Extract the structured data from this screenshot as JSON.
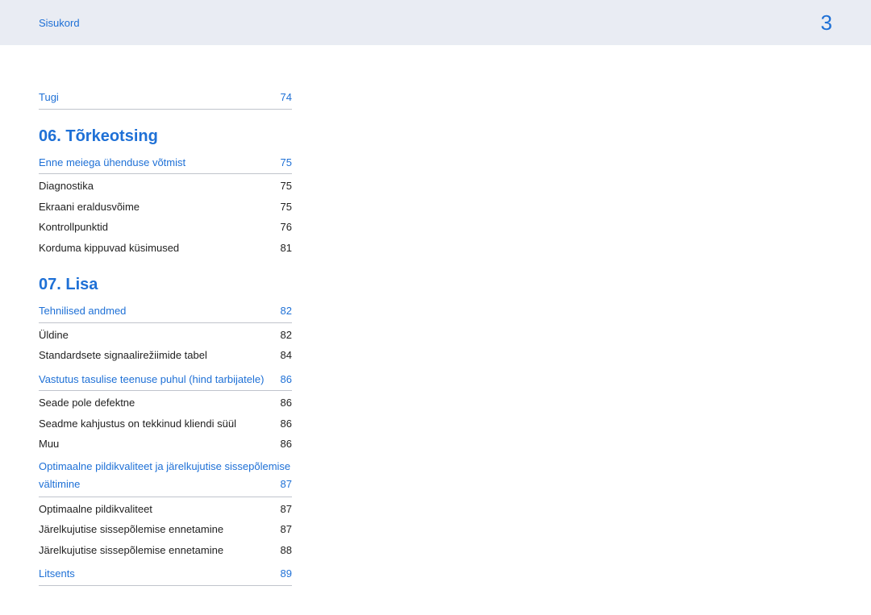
{
  "header": {
    "title": "Sisukord",
    "page": "3"
  },
  "sections": [
    {
      "heading": null,
      "groups": [
        {
          "subheading": {
            "label": "Tugi",
            "page": "74"
          },
          "items": []
        }
      ]
    },
    {
      "heading": "06. Tõrkeotsing",
      "groups": [
        {
          "subheading": {
            "label": "Enne meiega ühenduse võtmist",
            "page": "75"
          },
          "items": [
            {
              "label": "Diagnostika",
              "page": "75"
            },
            {
              "label": "Ekraani eraldusvõime",
              "page": "75"
            },
            {
              "label": "Kontrollpunktid",
              "page": "76"
            },
            {
              "label": "Korduma kippuvad küsimused",
              "page": "81"
            }
          ]
        }
      ]
    },
    {
      "heading": "07.  Lisa",
      "groups": [
        {
          "subheading": {
            "label": "Tehnilised andmed",
            "page": "82"
          },
          "items": [
            {
              "label": "Üldine",
              "page": "82"
            },
            {
              "label": "Standardsete signaalirežiimide tabel",
              "page": "84"
            }
          ]
        },
        {
          "subheading": {
            "label": "Vastutus tasulise teenuse puhul (hind tarbijatele)",
            "page": "86"
          },
          "items": [
            {
              "label": "Seade pole defektne",
              "page": "86"
            },
            {
              "label": "Seadme kahjustus on tekkinud kliendi süül",
              "page": "86"
            },
            {
              "label": "Muu",
              "page": "86"
            }
          ]
        },
        {
          "subheading_multiline": {
            "line1": "Optimaalne pildikvaliteet ja järelkujutise sissepõlemise",
            "line2": "vältimine",
            "page": "87"
          },
          "items": [
            {
              "label": "Optimaalne pildikvaliteet",
              "page": "87"
            },
            {
              "label": "Järelkujutise sissepõlemise ennetamine",
              "page": "87"
            },
            {
              "label": "Järelkujutise sissepõlemise ennetamine",
              "page": "88"
            }
          ]
        },
        {
          "subheading": {
            "label": "Litsents",
            "page": "89"
          },
          "items": []
        }
      ]
    }
  ]
}
